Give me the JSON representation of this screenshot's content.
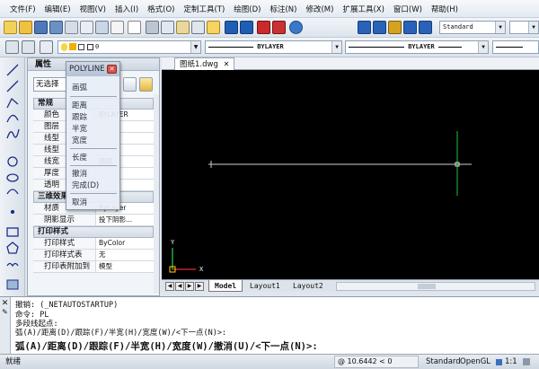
{
  "menu": [
    "文件(F)",
    "编辑(E)",
    "视图(V)",
    "插入(I)",
    "格式(O)",
    "定制工具(T)",
    "绘图(D)",
    "标注(N)",
    "修改(M)",
    "扩展工具(X)",
    "窗口(W)",
    "帮助(H)"
  ],
  "toolbar": {
    "text_style": "Standard",
    "layer_value": "0",
    "linetype": "BYLAYER",
    "lineweight": "BYLAYER"
  },
  "properties": {
    "title": "属性",
    "selection": "无选择",
    "sections": {
      "general": "常规",
      "three_d": "三维效果",
      "print": "打印样式"
    },
    "general_rows": [
      {
        "k": "颜色",
        "v": "BYLAYER"
      },
      {
        "k": "图层",
        "v": ""
      },
      {
        "k": "线型",
        "v": ""
      },
      {
        "k": "线型",
        "v": ""
      },
      {
        "k": "线宽",
        "v": "随层"
      },
      {
        "k": "厚度",
        "v": ""
      },
      {
        "k": "透明",
        "v": ""
      }
    ],
    "three_d_rows": [
      {
        "k": "材质",
        "v": "ByLayer"
      },
      {
        "k": "阴影显示",
        "v": "投下阴影..."
      }
    ],
    "print_rows": [
      {
        "k": "打印样式",
        "v": "ByColor"
      },
      {
        "k": "打印样式表",
        "v": "无"
      },
      {
        "k": "打印表附加到",
        "v": "模型"
      }
    ]
  },
  "popup": {
    "title": "POLYLINE",
    "items": [
      "画弧",
      "距离",
      "跟踪",
      "半宽",
      "宽度",
      "长度",
      "撤消",
      "完成(D)",
      "取消"
    ]
  },
  "doc_tab": "图纸1.dwg",
  "layout_tabs": [
    "Model",
    "Layout1",
    "Layout2"
  ],
  "command": {
    "lines": [
      "撤销: (_NETAUTOSTARTUP)",
      "命令: PL",
      "多段线起点:",
      "弧(A)/距离(D)/跟踪(F)/半宽(H)/宽度(W)/<下一点(N)>:"
    ],
    "prompt": "弧(A)/距离(D)/跟踪(F)/半宽(H)/宽度(W)/撤消(U)/<下一点(N)>:"
  },
  "status": {
    "left": "就绪",
    "coords": "@ 10.6442 < 0",
    "right": [
      "Standard",
      "OpenGL",
      "1:1"
    ]
  },
  "ucs": {
    "y": "Y",
    "x": "X"
  }
}
